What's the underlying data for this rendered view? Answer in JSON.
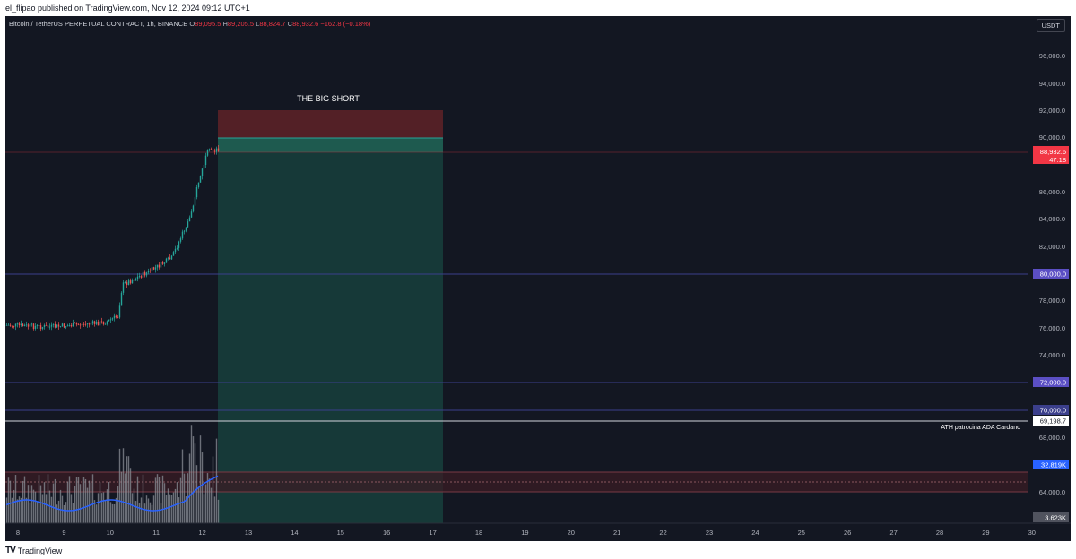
{
  "header": {
    "published": "el_flipao published on TradingView.com, Nov 12, 2024 09:12 UTC+1"
  },
  "legend": {
    "symbol": "Bitcoin / TetherUS PERPETUAL CONTRACT, 1h, BINANCE",
    "o_label": "O",
    "o": "89,095.5",
    "h_label": "H",
    "h": "89,205.5",
    "l_label": "L",
    "l": "88,824.7",
    "c_label": "C",
    "c": "88,932.6",
    "change": "−162.8 (−0.18%)"
  },
  "currency_button": "USDT",
  "price_axis": {
    "ticks": [
      "96,000.0",
      "94,000.0",
      "92,000.0",
      "90,000.0",
      "86,000.0",
      "84,000.0",
      "82,000.0",
      "78,000.0",
      "76,000.0",
      "74,000.0",
      "68,000.0",
      "64,000.0"
    ],
    "current_price": "88,932.6",
    "countdown": "47:18",
    "badges": [
      "80,000.0",
      "72,000.0",
      "70,000.0"
    ],
    "ath_badge": "69,198.7",
    "volume_ma_badge": "32.819K",
    "volume_badge": "3.623K"
  },
  "time_axis": {
    "ticks": [
      "8",
      "9",
      "10",
      "11",
      "12",
      "13",
      "14",
      "15",
      "16",
      "17",
      "18",
      "19",
      "20",
      "21",
      "22",
      "23",
      "24",
      "25",
      "26",
      "27",
      "28",
      "29",
      "30"
    ]
  },
  "drawings": {
    "position_label": "THE BIG SHORT",
    "ath_label": "ATH patrocina ADA Cardano"
  },
  "colors": {
    "background": "#131722",
    "up": "#26a69a",
    "down": "#ef5350",
    "short_loss_zone": "#5b2127",
    "short_profit_zone": "#163b3a",
    "level_line": "#5b4fc4",
    "current_price": "#f23645",
    "volume_ma": "#2962ff"
  },
  "footer": {
    "brand": "TradingView"
  }
}
